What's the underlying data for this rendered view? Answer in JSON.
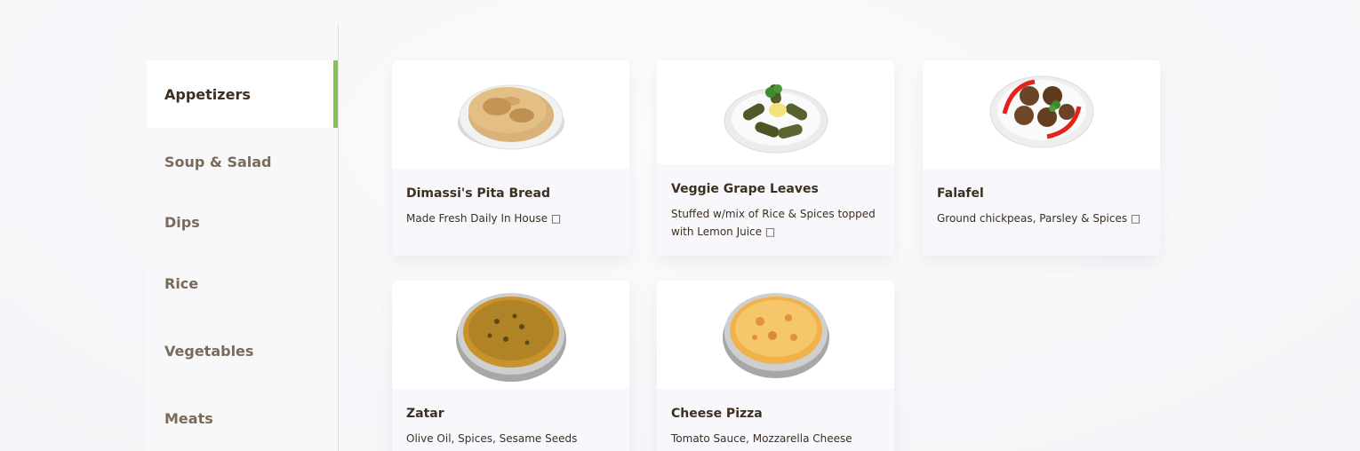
{
  "sidebar": {
    "categories": [
      {
        "label": "Appetizers",
        "active": true
      },
      {
        "label": "Soup & Salad",
        "active": false
      },
      {
        "label": "Dips",
        "active": false
      },
      {
        "label": "Rice",
        "active": false
      },
      {
        "label": "Vegetables",
        "active": false
      },
      {
        "label": "Meats",
        "active": false
      }
    ],
    "accent_color": "#86c452"
  },
  "menu": {
    "items": [
      {
        "name": "Dimassi's Pita Bread",
        "description": "Made Fresh Daily In House □",
        "image": "pita-bread-plate"
      },
      {
        "name": "Veggie Grape Leaves",
        "description": "Stuffed w/mix of Rice & Spices topped with Lemon Juice □",
        "image": "grape-leaves-plate"
      },
      {
        "name": "Falafel",
        "description": "Ground chickpeas, Parsley & Spices □",
        "image": "falafel-plate"
      },
      {
        "name": "Zatar",
        "description": "Olive Oil, Spices, Sesame Seeds",
        "image": "zatar-pizza"
      },
      {
        "name": "Cheese Pizza",
        "description": "Tomato Sauce, Mozzarella Cheese",
        "image": "cheese-pizza"
      }
    ]
  },
  "colors": {
    "text_dark": "#3d2f1f",
    "text_muted": "#7a6a58",
    "card_bg": "#f7f7fc"
  }
}
